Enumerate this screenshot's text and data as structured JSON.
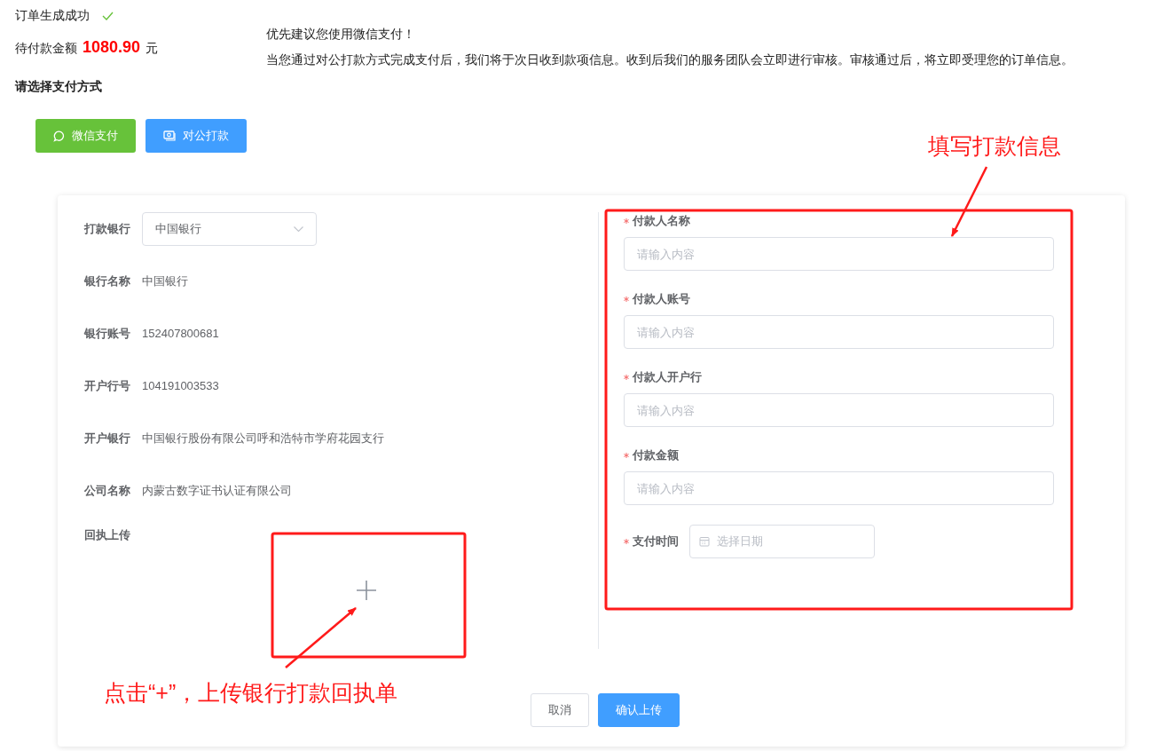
{
  "status": {
    "text": "订单生成成功",
    "success": true
  },
  "amount": {
    "label": "待付款金额",
    "value": "1080.90",
    "unit": "元"
  },
  "prompt": "请选择支付方式",
  "notice": [
    "优先建议您使用微信支付！",
    "当您通过对公打款方式完成支付后，我们将于次日收到款项信息。收到后我们的服务团队会立即进行审核。审核通过后，将立即受理您的订单信息。"
  ],
  "payment_methods": [
    {
      "label": "微信支付",
      "kind": "wechat"
    },
    {
      "label": "对公打款",
      "kind": "transfer"
    }
  ],
  "bank_form": {
    "select": {
      "label": "打款银行",
      "value": "中国银行"
    },
    "info": [
      {
        "label": "银行名称",
        "value": "中国银行"
      },
      {
        "label": "银行账号",
        "value": "152407800681"
      },
      {
        "label": "开户行号",
        "value": "104191003533"
      },
      {
        "label": "开户银行",
        "value": "中国银行股份有限公司呼和浩特市学府花园支行"
      },
      {
        "label": "公司名称",
        "value": "内蒙古数字证书认证有限公司"
      }
    ],
    "upload": {
      "label": "回执上传"
    }
  },
  "payer_form": {
    "fields": [
      {
        "label": "付款人名称",
        "required": true,
        "placeholder": "请输入内容"
      },
      {
        "label": "付款人账号",
        "required": true,
        "placeholder": "请输入内容"
      },
      {
        "label": "付款人开户行",
        "required": true,
        "placeholder": "请输入内容"
      },
      {
        "label": "付款金额",
        "required": true,
        "placeholder": "请输入内容"
      }
    ],
    "date": {
      "label": "支付时间",
      "required": true,
      "placeholder": "选择日期"
    }
  },
  "actions": [
    {
      "label": "取消",
      "kind": "secondary"
    },
    {
      "label": "确认上传",
      "kind": "primary"
    }
  ],
  "annotations": [
    {
      "text": "填写打款信息",
      "kind": "top"
    },
    {
      "text": "点击“+”，上传银行打款回执单",
      "kind": "bottom"
    }
  ]
}
